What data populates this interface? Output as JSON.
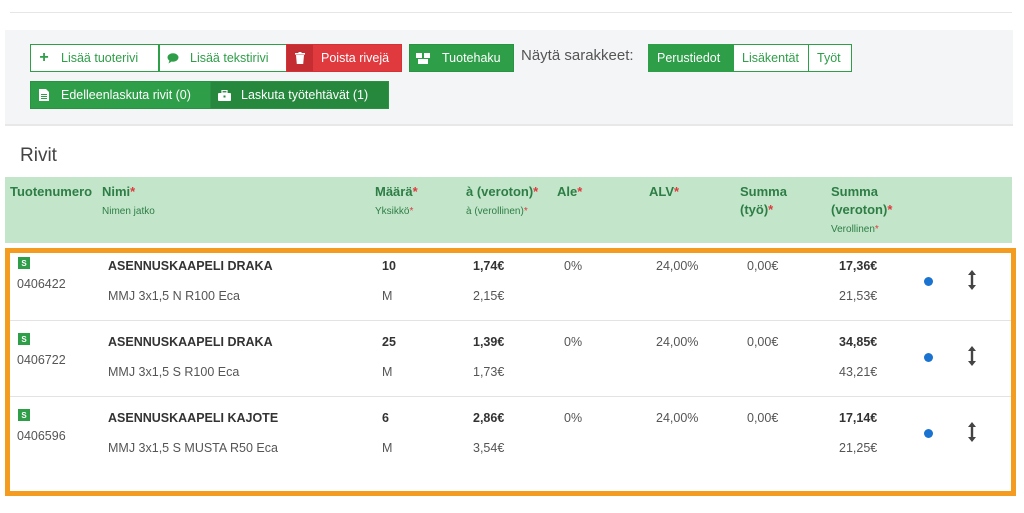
{
  "toolbar": {
    "add_product_row": "Lisää tuoterivi",
    "add_text_row": "Lisää tekstirivi",
    "delete_rows": "Poista rivejä",
    "product_search": "Tuotehaku",
    "show_columns_label": "Näytä sarakkeet:",
    "column_basic": "Perustiedot",
    "column_additional": "Lisäkentät",
    "column_work": "Työt",
    "reinvoice_rows": "Edelleenlaskuta rivit (0)",
    "invoice_tasks": "Laskuta työtehtävät (1)"
  },
  "section_title": "Rivit",
  "table_headers": {
    "product_number": "Tuotenumero",
    "name": "Nimi",
    "name_continued": "Nimen jatko",
    "quantity": "Määrä",
    "unit": "Yksikkö",
    "price_excl_tax": "à (veroton)",
    "price_incl_tax": "à (verollinen)",
    "discount": "Ale",
    "vat": "ALV",
    "sum_work_line1": "Summa",
    "sum_work_line2": "(työ)",
    "sum_excl_line1": "Summa",
    "sum_excl_line2": "(veroton)",
    "sum_incl_tax": "Verollinen"
  },
  "rows": [
    {
      "badge": "S",
      "product_number": "0406422",
      "name": "ASENNUSKAAPELI DRAKA",
      "name_continued": "MMJ 3x1,5 N R100 Eca",
      "quantity": "10",
      "unit": "M",
      "price_excl": "1,74€",
      "price_incl": "2,15€",
      "discount": "0%",
      "vat": "24,00%",
      "sum_work": "0,00€",
      "sum_excl": "17,36€",
      "sum_incl": "21,53€"
    },
    {
      "badge": "S",
      "product_number": "0406722",
      "name": "ASENNUSKAAPELI DRAKA",
      "name_continued": "MMJ 3x1,5 S R100 Eca",
      "quantity": "25",
      "unit": "M",
      "price_excl": "1,39€",
      "price_incl": "1,73€",
      "discount": "0%",
      "vat": "24,00%",
      "sum_work": "0,00€",
      "sum_excl": "34,85€",
      "sum_incl": "43,21€"
    },
    {
      "badge": "S",
      "product_number": "0406596",
      "name": "ASENNUSKAAPELI KAJOTE",
      "name_continued": "MMJ 3x1,5 S MUSTA R50 Eca",
      "quantity": "6",
      "unit": "M",
      "price_excl": "2,86€",
      "price_incl": "3,54€",
      "discount": "0%",
      "vat": "24,00%",
      "sum_work": "0,00€",
      "sum_excl": "17,14€",
      "sum_incl": "21,25€"
    }
  ],
  "colors": {
    "accent_green": "#2e9e48",
    "header_bg": "#c3e6cb",
    "danger_red": "#e0393e",
    "highlight_orange": "#f39c1f",
    "status_dot_blue": "#1a73d0"
  },
  "icons": {
    "add": "plus-icon",
    "text_row": "speech-bubble-icon",
    "delete": "trash-icon",
    "search": "boxes-icon",
    "document": "document-icon",
    "invoice": "toolbox-icon",
    "status": "status-dot-icon",
    "drag": "vertical-arrows-icon"
  }
}
